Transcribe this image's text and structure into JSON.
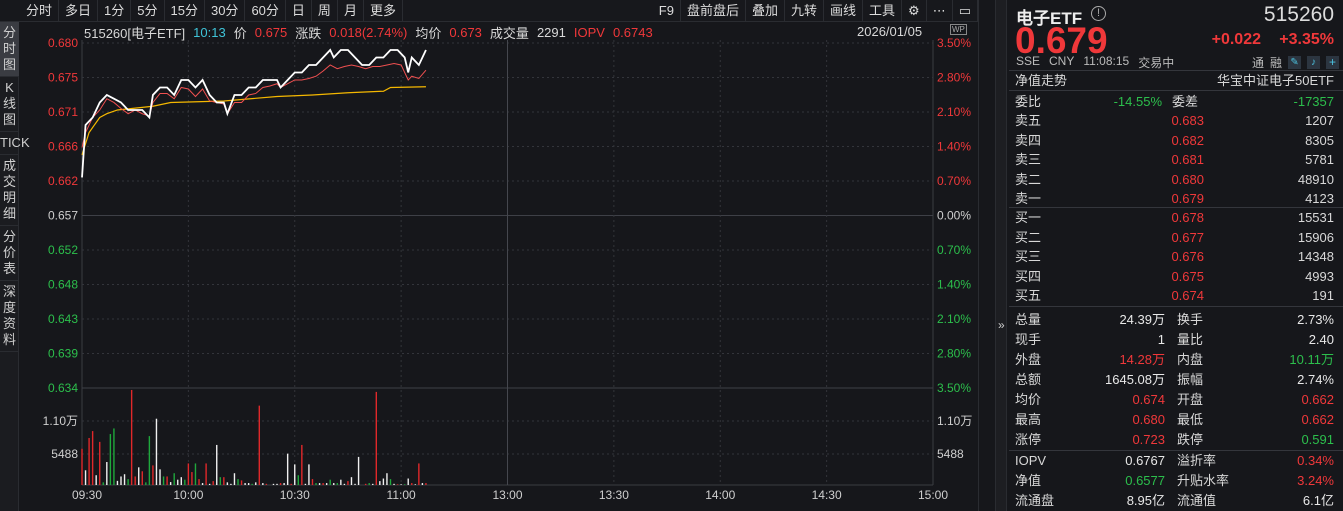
{
  "toolbar": {
    "periods": [
      "分时",
      "多日",
      "1分",
      "5分",
      "15分",
      "30分",
      "60分",
      "日",
      "周",
      "月",
      "更多"
    ],
    "right": [
      "F9",
      "盘前盘后",
      "叠加",
      "九转",
      "画线",
      "工具"
    ]
  },
  "sidetabs": [
    "分时图",
    "K线图",
    "TICK",
    "成交明细",
    "分价表",
    "深度资料"
  ],
  "header": {
    "code_name": "515260[电子ETF]",
    "time": "10:13",
    "price_label": "价",
    "price": "0.675",
    "change_label": "涨跌",
    "change": "0.018(2.74%)",
    "avg_label": "均价",
    "avg": "0.673",
    "vol_label": "成交量",
    "vol": "2291",
    "iopv_label": "IOPV",
    "iopv": "0.6743",
    "date": "2026/01/05",
    "wp": "WP"
  },
  "colors": {
    "up": "#f0383a",
    "down": "#2cbf4c",
    "price": "#ffffff",
    "avg": "#f5b800",
    "iopv": "#f05050"
  },
  "chart_data": {
    "type": "line",
    "prev_close": 0.657,
    "left_ticks": [
      "0.680",
      "0.675",
      "0.671",
      "0.666",
      "0.662",
      "0.657",
      "0.652",
      "0.648",
      "0.643",
      "0.639",
      "0.634"
    ],
    "right_ticks": [
      "3.50%",
      "2.80%",
      "2.10%",
      "1.40%",
      "0.70%",
      "0.00%",
      "0.70%",
      "1.40%",
      "2.10%",
      "2.80%",
      "3.50%"
    ],
    "vol_ticks": [
      "1.10万",
      "5488"
    ],
    "vol_max": 16464,
    "x_ticks": [
      "09:30",
      "10:00",
      "10:30",
      "11:00",
      "13:00",
      "13:30",
      "14:00",
      "14:30",
      "15:00"
    ],
    "total_minutes": 240,
    "price": [
      [
        0,
        0.662
      ],
      [
        1,
        0.669
      ],
      [
        3,
        0.67
      ],
      [
        5,
        0.672
      ],
      [
        7,
        0.673
      ],
      [
        9,
        0.6725
      ],
      [
        11,
        0.672
      ],
      [
        13,
        0.671
      ],
      [
        15,
        0.671
      ],
      [
        17,
        0.671
      ],
      [
        19,
        0.67
      ],
      [
        20,
        0.673
      ],
      [
        22,
        0.674
      ],
      [
        24,
        0.674
      ],
      [
        26,
        0.673
      ],
      [
        28,
        0.675
      ],
      [
        30,
        0.675
      ],
      [
        32,
        0.674
      ],
      [
        34,
        0.675
      ],
      [
        36,
        0.673
      ],
      [
        38,
        0.672
      ],
      [
        40,
        0.672
      ],
      [
        41,
        0.6705
      ],
      [
        43,
        0.673
      ],
      [
        45,
        0.673
      ],
      [
        47,
        0.674
      ],
      [
        49,
        0.674
      ],
      [
        51,
        0.675
      ],
      [
        53,
        0.675
      ],
      [
        55,
        0.675
      ],
      [
        56,
        0.674
      ],
      [
        58,
        0.675
      ],
      [
        60,
        0.676
      ],
      [
        62,
        0.676
      ],
      [
        64,
        0.677
      ],
      [
        66,
        0.677
      ],
      [
        68,
        0.678
      ],
      [
        70,
        0.679
      ],
      [
        71,
        0.678
      ],
      [
        73,
        0.679
      ],
      [
        75,
        0.679
      ],
      [
        77,
        0.678
      ],
      [
        79,
        0.677
      ],
      [
        81,
        0.677
      ],
      [
        83,
        0.678
      ],
      [
        85,
        0.678
      ],
      [
        87,
        0.679
      ],
      [
        89,
        0.679
      ],
      [
        91,
        0.678
      ],
      [
        92,
        0.676
      ],
      [
        93,
        0.678
      ],
      [
        95,
        0.677
      ],
      [
        96,
        0.678
      ],
      [
        97,
        0.679
      ]
    ],
    "iopv": [
      [
        0,
        0.666
      ],
      [
        1,
        0.668
      ],
      [
        3,
        0.67
      ],
      [
        5,
        0.671
      ],
      [
        7,
        0.6725
      ],
      [
        9,
        0.672
      ],
      [
        11,
        0.6712
      ],
      [
        13,
        0.6705
      ],
      [
        15,
        0.671
      ],
      [
        17,
        0.6705
      ],
      [
        19,
        0.6702
      ],
      [
        20,
        0.672
      ],
      [
        22,
        0.6732
      ],
      [
        24,
        0.6732
      ],
      [
        26,
        0.6725
      ],
      [
        28,
        0.674
      ],
      [
        30,
        0.6738
      ],
      [
        32,
        0.6728
      ],
      [
        34,
        0.6738
      ],
      [
        36,
        0.6722
      ],
      [
        38,
        0.672
      ],
      [
        40,
        0.6718
      ],
      [
        41,
        0.6705
      ],
      [
        43,
        0.672
      ],
      [
        45,
        0.672
      ],
      [
        47,
        0.673
      ],
      [
        49,
        0.6732
      ],
      [
        51,
        0.674
      ],
      [
        53,
        0.6742
      ],
      [
        55,
        0.6745
      ],
      [
        56,
        0.674
      ],
      [
        58,
        0.6745
      ],
      [
        60,
        0.675
      ],
      [
        62,
        0.675
      ],
      [
        64,
        0.6752
      ],
      [
        66,
        0.6755
      ],
      [
        68,
        0.6762
      ],
      [
        70,
        0.677
      ],
      [
        72,
        0.6765
      ],
      [
        74,
        0.6768
      ],
      [
        76,
        0.677
      ],
      [
        78,
        0.6768
      ],
      [
        80,
        0.6765
      ],
      [
        82,
        0.6768
      ],
      [
        84,
        0.6768
      ],
      [
        86,
        0.677
      ],
      [
        88,
        0.6772
      ],
      [
        90,
        0.677
      ],
      [
        92,
        0.675
      ],
      [
        93,
        0.6755
      ],
      [
        95,
        0.6752
      ],
      [
        97,
        0.6763
      ]
    ],
    "avg": [
      [
        0,
        0.665
      ],
      [
        2,
        0.668
      ],
      [
        5,
        0.67
      ],
      [
        7,
        0.6705
      ],
      [
        10,
        0.671
      ],
      [
        20,
        0.6715
      ],
      [
        25,
        0.672
      ],
      [
        40,
        0.6722
      ],
      [
        55,
        0.6728
      ],
      [
        65,
        0.673
      ],
      [
        75,
        0.6733
      ],
      [
        85,
        0.6735
      ],
      [
        87,
        0.674
      ],
      [
        97,
        0.6741
      ]
    ],
    "volume": [
      [
        0,
        6150,
        "r"
      ],
      [
        1,
        2500,
        "w"
      ],
      [
        2,
        7980,
        "r"
      ],
      [
        3,
        9150,
        "r"
      ],
      [
        4,
        1660,
        "w"
      ],
      [
        5,
        7320,
        "r"
      ],
      [
        6,
        450,
        "g"
      ],
      [
        7,
        3900,
        "w"
      ],
      [
        8,
        8650,
        "g"
      ],
      [
        9,
        9600,
        "g"
      ],
      [
        10,
        700,
        "w"
      ],
      [
        11,
        1450,
        "w"
      ],
      [
        12,
        1830,
        "w"
      ],
      [
        13,
        1000,
        "g"
      ],
      [
        14,
        16130,
        "r"
      ],
      [
        15,
        1450,
        "r"
      ],
      [
        16,
        3000,
        "w"
      ],
      [
        17,
        2330,
        "r"
      ],
      [
        18,
        450,
        "g"
      ],
      [
        19,
        8300,
        "g"
      ],
      [
        20,
        3330,
        "r"
      ],
      [
        21,
        11250,
        "w"
      ],
      [
        22,
        2660,
        "w"
      ],
      [
        23,
        1450,
        "g"
      ],
      [
        24,
        1450,
        "r"
      ],
      [
        25,
        500,
        "w"
      ],
      [
        26,
        2000,
        "g"
      ],
      [
        27,
        900,
        "w"
      ],
      [
        28,
        1330,
        "w"
      ],
      [
        29,
        900,
        "g"
      ],
      [
        30,
        3660,
        "r"
      ],
      [
        31,
        2200,
        "r"
      ],
      [
        32,
        3660,
        "g"
      ],
      [
        33,
        1000,
        "r"
      ],
      [
        34,
        330,
        "w"
      ],
      [
        35,
        3660,
        "r"
      ],
      [
        36,
        200,
        "w"
      ],
      [
        37,
        660,
        "r"
      ],
      [
        38,
        6800,
        "w"
      ],
      [
        39,
        1330,
        "g"
      ],
      [
        40,
        1330,
        "r"
      ],
      [
        41,
        450,
        "w"
      ],
      [
        42,
        200,
        "w"
      ],
      [
        43,
        2000,
        "w"
      ],
      [
        44,
        1000,
        "g"
      ],
      [
        45,
        780,
        "r"
      ],
      [
        46,
        330,
        "w"
      ],
      [
        47,
        330,
        "w"
      ],
      [
        48,
        200,
        "g"
      ],
      [
        49,
        450,
        "w"
      ],
      [
        50,
        13470,
        "r"
      ],
      [
        51,
        330,
        "w"
      ],
      [
        52,
        200,
        "r"
      ],
      [
        54,
        200,
        "w"
      ],
      [
        55,
        200,
        "w"
      ],
      [
        56,
        330,
        "r"
      ],
      [
        57,
        330,
        "w"
      ],
      [
        58,
        5320,
        "w"
      ],
      [
        59,
        200,
        "r"
      ],
      [
        60,
        3500,
        "w"
      ],
      [
        61,
        1660,
        "g"
      ],
      [
        62,
        6800,
        "r"
      ],
      [
        63,
        200,
        "w"
      ],
      [
        64,
        3500,
        "w"
      ],
      [
        65,
        1000,
        "r"
      ],
      [
        66,
        330,
        "g"
      ],
      [
        67,
        330,
        "w"
      ],
      [
        68,
        330,
        "r"
      ],
      [
        69,
        330,
        "w"
      ],
      [
        70,
        900,
        "g"
      ],
      [
        71,
        330,
        "w"
      ],
      [
        72,
        330,
        "g"
      ],
      [
        73,
        900,
        "w"
      ],
      [
        74,
        200,
        "w"
      ],
      [
        75,
        660,
        "r"
      ],
      [
        76,
        1330,
        "w"
      ],
      [
        77,
        200,
        "w"
      ],
      [
        78,
        4770,
        "w"
      ],
      [
        80,
        200,
        "r"
      ],
      [
        81,
        330,
        "g"
      ],
      [
        82,
        200,
        "w"
      ],
      [
        83,
        15800,
        "r"
      ],
      [
        84,
        660,
        "w"
      ],
      [
        85,
        1100,
        "w"
      ],
      [
        86,
        2000,
        "w"
      ],
      [
        87,
        1000,
        "g"
      ],
      [
        88,
        200,
        "w"
      ],
      [
        89,
        120,
        "r"
      ],
      [
        90,
        120,
        "w"
      ],
      [
        91,
        120,
        "g"
      ],
      [
        92,
        1100,
        "w"
      ],
      [
        93,
        330,
        "r"
      ],
      [
        94,
        120,
        "w"
      ],
      [
        95,
        3660,
        "r"
      ],
      [
        96,
        330,
        "w"
      ],
      [
        97,
        330,
        "r"
      ]
    ]
  },
  "quote": {
    "name": "电子ETF",
    "code": "515260",
    "price": "0.679",
    "change": "+0.022",
    "pct": "+3.35%",
    "exchange": "SSE",
    "currency": "CNY",
    "time": "11:08:15",
    "status": "交易中",
    "tong": "通",
    "rong": "融"
  },
  "nav_trend": {
    "label": "净值走势",
    "fund": "华宝中证电子50ETF"
  },
  "ratio": {
    "label1": "委比",
    "val1": "-14.55%",
    "label2": "委差",
    "val2": "-17357"
  },
  "asks": [
    {
      "label": "卖五",
      "price": "0.683",
      "vol": "1207"
    },
    {
      "label": "卖四",
      "price": "0.682",
      "vol": "8305"
    },
    {
      "label": "卖三",
      "price": "0.681",
      "vol": "5781"
    },
    {
      "label": "卖二",
      "price": "0.680",
      "vol": "48910"
    },
    {
      "label": "卖一",
      "price": "0.679",
      "vol": "4123"
    }
  ],
  "bids": [
    {
      "label": "买一",
      "price": "0.678",
      "vol": "15531"
    },
    {
      "label": "买二",
      "price": "0.677",
      "vol": "15906"
    },
    {
      "label": "买三",
      "price": "0.676",
      "vol": "14348"
    },
    {
      "label": "买四",
      "price": "0.675",
      "vol": "4993"
    },
    {
      "label": "买五",
      "price": "0.674",
      "vol": "191"
    }
  ],
  "stats": [
    {
      "l1": "总量",
      "v1": "24.39万",
      "c1": "white",
      "l2": "换手",
      "v2": "2.73%",
      "c2": "white"
    },
    {
      "l1": "现手",
      "v1": "1",
      "c1": "white",
      "l2": "量比",
      "v2": "2.40",
      "c2": "white"
    },
    {
      "l1": "外盘",
      "v1": "14.28万",
      "c1": "red",
      "l2": "内盘",
      "v2": "10.11万",
      "c2": "green"
    },
    {
      "l1": "总额",
      "v1": "1645.08万",
      "c1": "white",
      "l2": "振幅",
      "v2": "2.74%",
      "c2": "white"
    },
    {
      "l1": "均价",
      "v1": "0.674",
      "c1": "red",
      "l2": "开盘",
      "v2": "0.662",
      "c2": "red"
    },
    {
      "l1": "最高",
      "v1": "0.680",
      "c1": "red",
      "l2": "最低",
      "v2": "0.662",
      "c2": "red"
    },
    {
      "l1": "涨停",
      "v1": "0.723",
      "c1": "red",
      "l2": "跌停",
      "v2": "0.591",
      "c2": "green"
    }
  ],
  "fund_stats": [
    {
      "l1": "IOPV",
      "v1": "0.6767",
      "c1": "white",
      "l2": "溢折率",
      "v2": "0.34%",
      "c2": "red"
    },
    {
      "l1": "净值",
      "v1": "0.6577",
      "c1": "green",
      "l2": "升贴水率",
      "v2": "3.24%",
      "c2": "red"
    },
    {
      "l1": "流通盘",
      "v1": "8.95亿",
      "c1": "white",
      "l2": "流通值",
      "v2": "6.1亿",
      "c2": "white"
    }
  ],
  "expand_label": "»"
}
